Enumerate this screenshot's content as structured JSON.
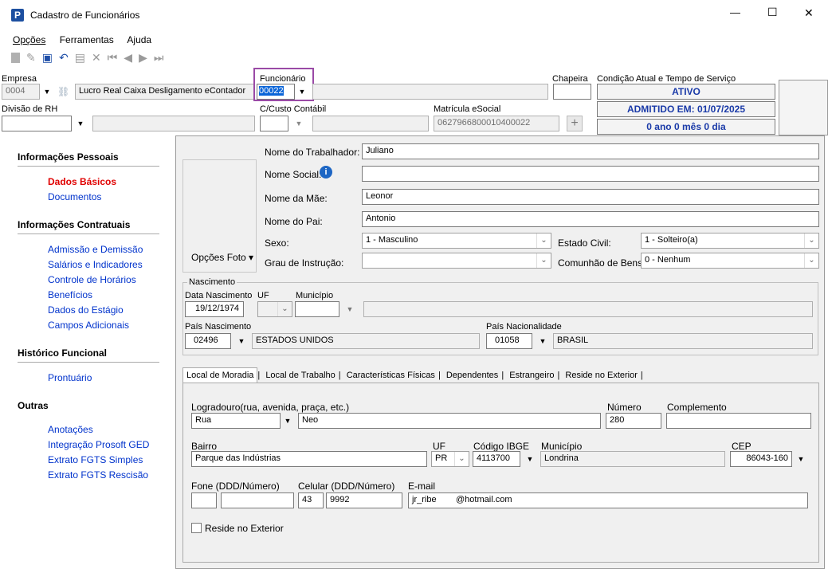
{
  "window": {
    "title": "Cadastro de Funcionários",
    "minimize": "—",
    "maximize": "☐",
    "close": "✕"
  },
  "menu": {
    "opcoes": "Opções",
    "ferramentas": "Ferramentas",
    "ajuda": "Ajuda"
  },
  "header": {
    "empresa_label": "Empresa",
    "empresa_code": "0004",
    "empresa_name": "Lucro Real Caixa Desligamento eContador",
    "funcionario_label": "Funcionário",
    "funcionario_value": "00022",
    "chapeira_label": "Chapeira",
    "condicao_label": "Condição Atual e Tempo de Serviço",
    "status": "ATIVO",
    "admitido": "ADMITIDO EM: 01/07/2025",
    "tempo": "0 ano 0 mês 0 dia",
    "divisao_label": "Divisão de RH",
    "custo_label": "C/Custo Contábil",
    "matricula_label": "Matrícula eSocial",
    "matricula_value": "0627966800010400022"
  },
  "sidebar": {
    "g1": "Informações Pessoais",
    "dados_basicos": "Dados Básicos",
    "documentos": "Documentos",
    "g2": "Informações Contratuais",
    "admissao": "Admissão e Demissão",
    "salarios": "Salários e Indicadores",
    "controle": "Controle de Horários",
    "beneficios": "Benefícios",
    "estagio": "Dados do Estágio",
    "campos": "Campos Adicionais",
    "g3": "Histórico Funcional",
    "prontuario": "Prontuário",
    "g4": "Outras",
    "anotacoes": "Anotações",
    "integracao": "Integração Prosoft GED",
    "fgts_simples": "Extrato FGTS Simples",
    "fgts_rescisao": "Extrato FGTS Rescisão"
  },
  "form": {
    "opcoes_foto": "Opções Foto ▾",
    "nome_label": "Nome do Trabalhador:",
    "nome": "Juliano",
    "social_label": "Nome Social:",
    "social": "",
    "mae_label": "Nome da Mãe:",
    "mae": "Leonor",
    "pai_label": "Nome do Pai:",
    "pai": "Antonio",
    "sexo_label": "Sexo:",
    "sexo": "1 - Masculino",
    "civil_label": "Estado Civil:",
    "civil": "1 - Solteiro(a)",
    "grau_label": "Grau de Instrução:",
    "grau": "",
    "comunhao_label": "Comunhão de Bens:",
    "comunhao": "0 - Nenhum"
  },
  "nascimento": {
    "group": "Nascimento",
    "data_label": "Data Nascimento",
    "data": "19/12/1974",
    "uf_label": "UF",
    "municipio_label": "Município",
    "pais_label": "País Nascimento",
    "pais_code": "02496",
    "pais_name": "ESTADOS UNIDOS",
    "nac_label": "País Nacionalidade",
    "nac_code": "01058",
    "nac_name": "BRASIL"
  },
  "tabs": [
    "Local de Moradia",
    "Local de Trabalho",
    "Características Físicas",
    "Dependentes",
    "Estrangeiro",
    "Reside no Exterior"
  ],
  "moradia": {
    "log_label": "Logradouro(rua, avenida, praça, etc.)",
    "log_tipo": "Rua",
    "log_nome": "Neo",
    "numero_label": "Número",
    "numero": "280",
    "compl_label": "Complemento",
    "bairro_label": "Bairro",
    "bairro": "Parque das Indústrias",
    "uf_label": "UF",
    "uf": "PR",
    "ibge_label": "Código IBGE",
    "ibge": "4113700",
    "mun_label": "Município",
    "mun": "Londrina",
    "cep_label": "CEP",
    "cep": "86043-160",
    "fone_label": "Fone (DDD/Número)",
    "cel_label": "Celular (DDD/Número)",
    "cel_ddd": "43",
    "cel_num": "9992",
    "email_label": "E-mail",
    "email": "jr_ribe        @hotmail.com",
    "reside": "Reside no Exterior"
  }
}
